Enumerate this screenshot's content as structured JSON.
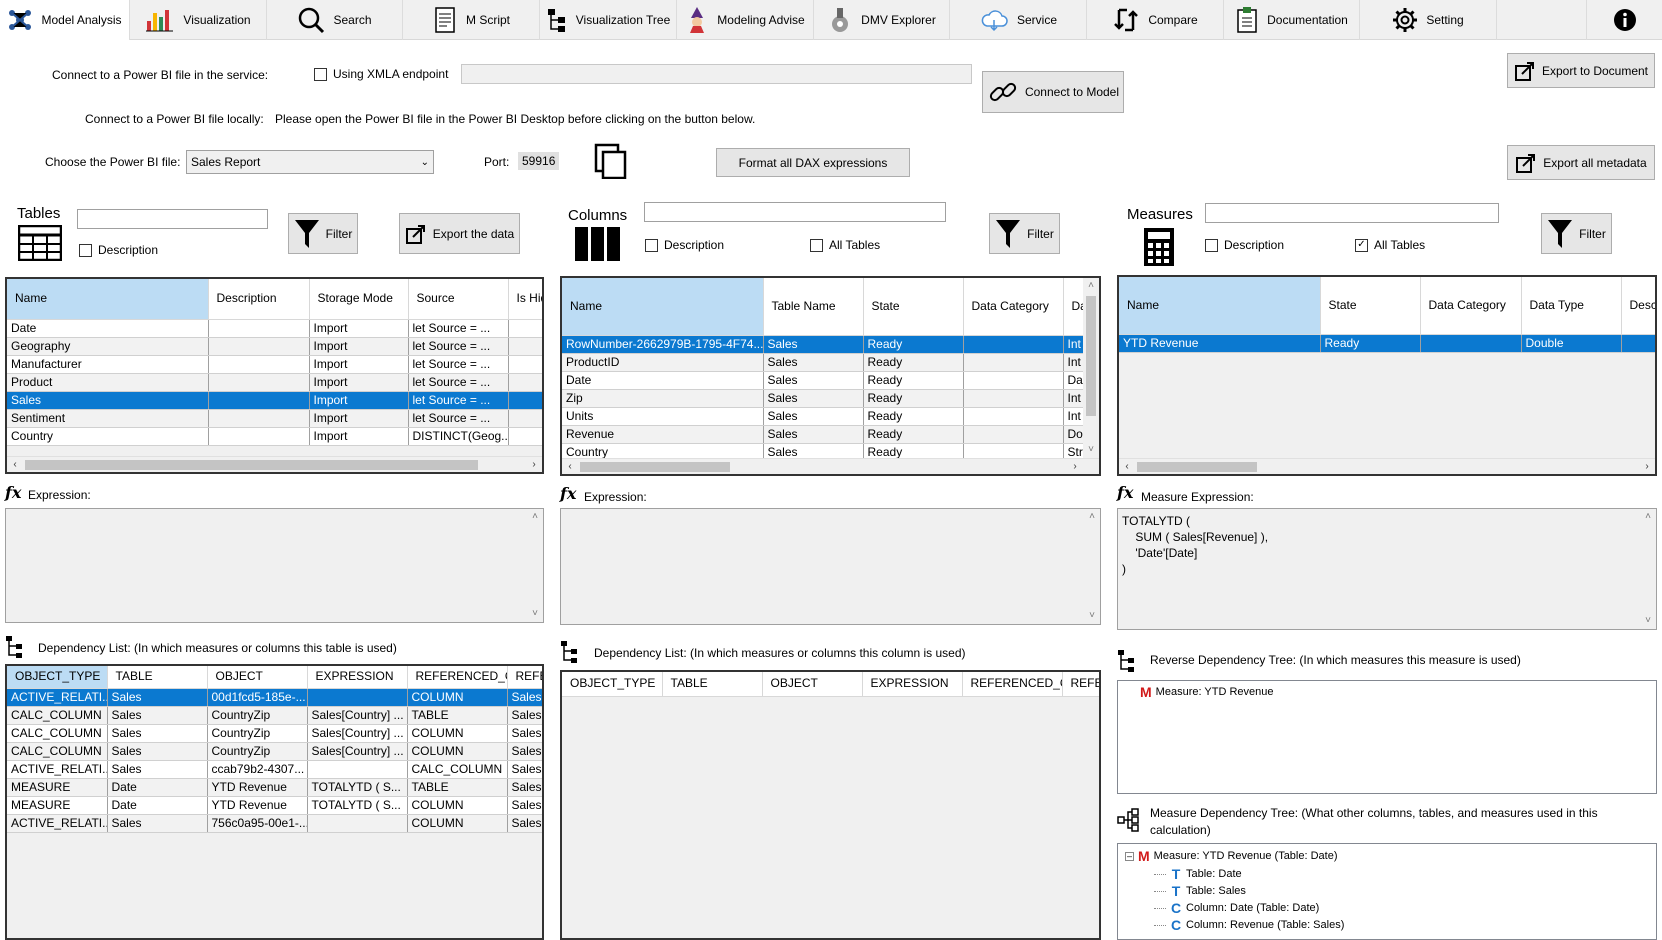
{
  "toolbar": {
    "tabs": [
      {
        "label": "Model Analysis",
        "icon": "network-icon"
      },
      {
        "label": "Visualization",
        "icon": "bar-chart-icon"
      },
      {
        "label": "Search",
        "icon": "search-icon"
      },
      {
        "label": "M Script",
        "icon": "script-icon"
      },
      {
        "label": "Visualization Tree",
        "icon": "tree-icon"
      },
      {
        "label": "Modeling Advise",
        "icon": "wizard-icon"
      },
      {
        "label": "DMV Explorer",
        "icon": "explorer-icon"
      },
      {
        "label": "Service",
        "icon": "cloud-icon"
      },
      {
        "label": "Compare",
        "icon": "compare-icon"
      },
      {
        "label": "Documentation",
        "icon": "clipboard-icon"
      },
      {
        "label": "Setting",
        "icon": "gear-icon"
      },
      {
        "label": "",
        "icon": "info-icon"
      }
    ]
  },
  "connect": {
    "service_label": "Connect to a Power BI file in the service:",
    "xmla_label": "Using XMLA endpoint",
    "xmla_value": "",
    "connect_model_label": "Connect to Model",
    "local_label": "Connect to a Power BI file locally:",
    "local_hint": "Please open the Power BI file in the Power BI Desktop before clicking on the button below.",
    "choose_label": "Choose the Power BI file:",
    "file_selected": "Sales Report",
    "port_label": "Port:",
    "port_value": "59916",
    "format_dax_label": "Format all DAX expressions",
    "export_doc_label": "Export to Document",
    "export_meta_label": "Export all metadata"
  },
  "tables_panel": {
    "title": "Tables",
    "filter_value": "",
    "description_label": "Description",
    "filter_label": "Filter",
    "export_label": "Export the data",
    "columns": [
      "Name",
      "Description",
      "Storage Mode",
      "Source",
      "Is Hid"
    ],
    "rows": [
      [
        "Date",
        "",
        "Import",
        "let    Source = ...",
        ""
      ],
      [
        "Geography",
        "",
        "Import",
        "let    Source = ...",
        ""
      ],
      [
        "Manufacturer",
        "",
        "Import",
        "let    Source = ...",
        ""
      ],
      [
        "Product",
        "",
        "Import",
        "let    Source = ...",
        ""
      ],
      [
        "Sales",
        "",
        "Import",
        "let    Source = ...",
        ""
      ],
      [
        "Sentiment",
        "",
        "Import",
        "let    Source = ...",
        ""
      ],
      [
        "Country",
        "",
        "Import",
        "DISTINCT(Geog...",
        ""
      ]
    ],
    "selected_index": 4,
    "expression_label": "Expression:",
    "dep_label": "Dependency List: (In which measures or columns this table is used)",
    "dep_columns": [
      "OBJECT_TYPE",
      "TABLE",
      "OBJECT",
      "EXPRESSION",
      "REFERENCED_OB...",
      "REFER"
    ],
    "dep_rows": [
      [
        "ACTIVE_RELATI...",
        "Sales",
        "00d1fcd5-185e-...",
        "",
        "COLUMN",
        "Sales"
      ],
      [
        "CALC_COLUMN",
        "Sales",
        "CountryZip",
        "Sales[Country] ...",
        "TABLE",
        "Sales"
      ],
      [
        "CALC_COLUMN",
        "Sales",
        "CountryZip",
        "Sales[Country] ...",
        "COLUMN",
        "Sales"
      ],
      [
        "CALC_COLUMN",
        "Sales",
        "CountryZip",
        "Sales[Country] ...",
        "COLUMN",
        "Sales"
      ],
      [
        "ACTIVE_RELATI...",
        "Sales",
        "ccab79b2-4307...",
        "",
        "CALC_COLUMN",
        "Sales"
      ],
      [
        "MEASURE",
        "Date",
        "YTD Revenue",
        "TOTALYTD (    S...",
        "TABLE",
        "Sales"
      ],
      [
        "MEASURE",
        "Date",
        "YTD Revenue",
        "TOTALYTD (    S...",
        "COLUMN",
        "Sales"
      ],
      [
        "ACTIVE_RELATI...",
        "Sales",
        "756c0a95-00e1-...",
        "",
        "COLUMN",
        "Sales"
      ]
    ]
  },
  "columns_panel": {
    "title": "Columns",
    "filter_value": "",
    "description_label": "Description",
    "all_tables_label": "All Tables",
    "filter_label": "Filter",
    "columns": [
      "Name",
      "Table Name",
      "State",
      "Data Category",
      "Da"
    ],
    "rows": [
      [
        "RowNumber-2662979B-1795-4F74...",
        "Sales",
        "Ready",
        "",
        "Int"
      ],
      [
        "ProductID",
        "Sales",
        "Ready",
        "",
        "Int"
      ],
      [
        "Date",
        "Sales",
        "Ready",
        "",
        "Dat"
      ],
      [
        "Zip",
        "Sales",
        "Ready",
        "",
        "Int"
      ],
      [
        "Units",
        "Sales",
        "Ready",
        "",
        "Int"
      ],
      [
        "Revenue",
        "Sales",
        "Ready",
        "",
        "Dou"
      ],
      [
        "Country",
        "Sales",
        "Ready",
        "",
        "Stri"
      ]
    ],
    "expression_label": "Expression:",
    "dep_label": "Dependency List: (In which measures or columns this column is used)",
    "dep_columns": [
      "OBJECT_TYPE",
      "TABLE",
      "OBJECT",
      "EXPRESSION",
      "REFERENCED_OB...",
      "REFER"
    ]
  },
  "measures_panel": {
    "title": "Measures",
    "filter_value": "",
    "description_label": "Description",
    "all_tables_label": "All Tables",
    "filter_label": "Filter",
    "columns": [
      "Name",
      "State",
      "Data Category",
      "Data Type",
      "Desc"
    ],
    "rows": [
      [
        "YTD Revenue",
        "Ready",
        "",
        "Double",
        ""
      ]
    ],
    "expression_label": "Measure Expression:",
    "expression_lines": [
      "TOTALYTD (",
      "    SUM ( Sales[Revenue] ),",
      "    'Date'[Date]",
      ")"
    ],
    "reverse_label": "Reverse Dependency Tree: (In which measures this measure is used)",
    "reverse_item": "Measure: YTD Revenue",
    "dep_tree_label": "Measure Dependency Tree: (What other columns, tables, and measures used in this calculation)",
    "dep_tree_root": "Measure: YTD Revenue (Table: Date)",
    "dep_tree_children": [
      {
        "type": "T",
        "label": "Table: Date"
      },
      {
        "type": "T",
        "label": "Table: Sales"
      },
      {
        "type": "C",
        "label": "Column: Date (Table: Date)"
      },
      {
        "type": "C",
        "label": "Column: Revenue (Table: Sales)"
      }
    ]
  },
  "colors": {
    "selection": "#0b79d0",
    "header_selected": "#bcdcf4",
    "measure_red": "#d11a1a",
    "tree_blue": "#1a73c8"
  }
}
